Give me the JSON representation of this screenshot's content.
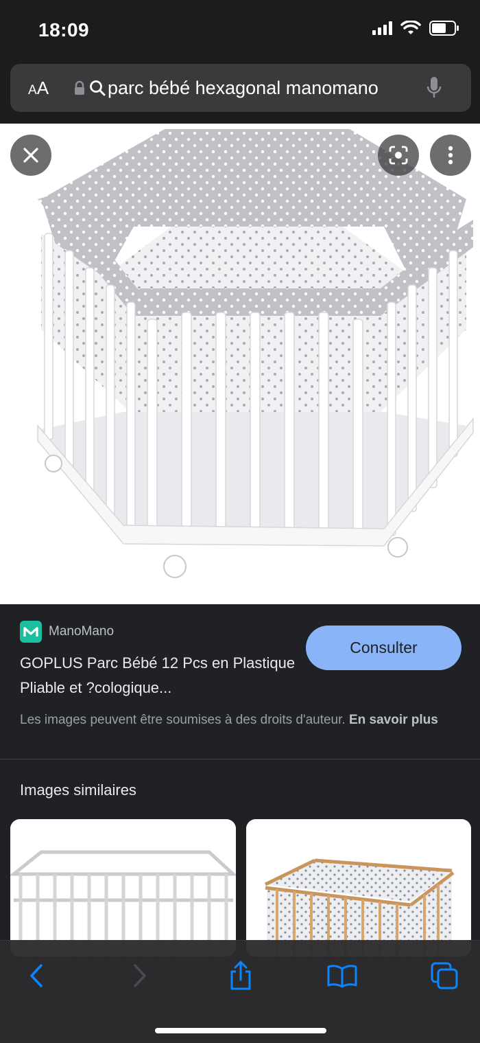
{
  "status_bar": {
    "time": "18:09"
  },
  "address_bar": {
    "text_size_label_big": "A",
    "text_size_label_small": "A",
    "url": "parc bébé hexagonal manomano"
  },
  "image_viewer": {
    "close_icon": "close-icon",
    "lens_icon": "lens-icon",
    "more_icon": "more-vertical-icon"
  },
  "result": {
    "source_name": "ManoMano",
    "source_logo_letter": "M",
    "title": "GOPLUS Parc Bébé 12 Pcs en Plastique Pliable et ?cologique...",
    "consult_label": "Consulter",
    "rights_text": "Les images peuvent être soumises à des droits d'auteur.",
    "rights_link": "En savoir plus",
    "accent": "#8ab4f8",
    "logo_color": "#1bbf9f"
  },
  "similar": {
    "title": "Images similaires"
  },
  "toolbar": {
    "items": [
      "back-icon",
      "forward-icon",
      "share-icon",
      "bookmarks-icon",
      "tabs-icon"
    ],
    "accent": "#0a84ff"
  }
}
